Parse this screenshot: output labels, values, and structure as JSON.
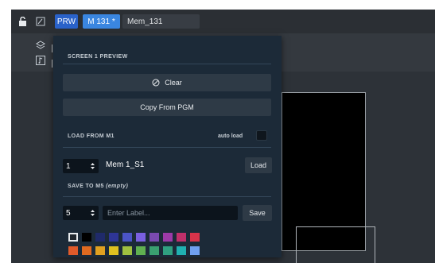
{
  "toolbar": {
    "prw_label": "PRW",
    "mem_tag": "M 131 *",
    "mem_name": "Mem_131",
    "lock_icon": "lock-icon",
    "edit_icon": "edit-icon"
  },
  "panel": {
    "preview_title": "SCREEN 1 PREVIEW",
    "clear_label": "Clear",
    "copy_label": "Copy From PGM",
    "load_title": "LOAD FROM M1",
    "autoload_label": "auto load",
    "load_number": "1",
    "load_memory": "Mem 1_S1",
    "load_button": "Load",
    "save_title": "SAVE TO M5",
    "save_status": "(empty)",
    "save_number": "5",
    "label_placeholder": "Enter Label...",
    "save_button": "Save"
  },
  "palette": [
    "#20262d",
    "#000000",
    "#1f2a6a",
    "#2e3596",
    "#4b54c6",
    "#7a5fe0",
    "#7a4ab0",
    "#9c3aa8",
    "#c0306a",
    "#d8334a",
    "#e05a2a",
    "#e06a20",
    "#e0a020",
    "#e0c020",
    "#a0c040",
    "#60b050",
    "#3aa070",
    "#30a080",
    "#20b0b0",
    "#70a0f0"
  ],
  "colors": {
    "accent": "#2a62c9",
    "tag": "#3a86e0",
    "panel": "#1c2a38"
  }
}
